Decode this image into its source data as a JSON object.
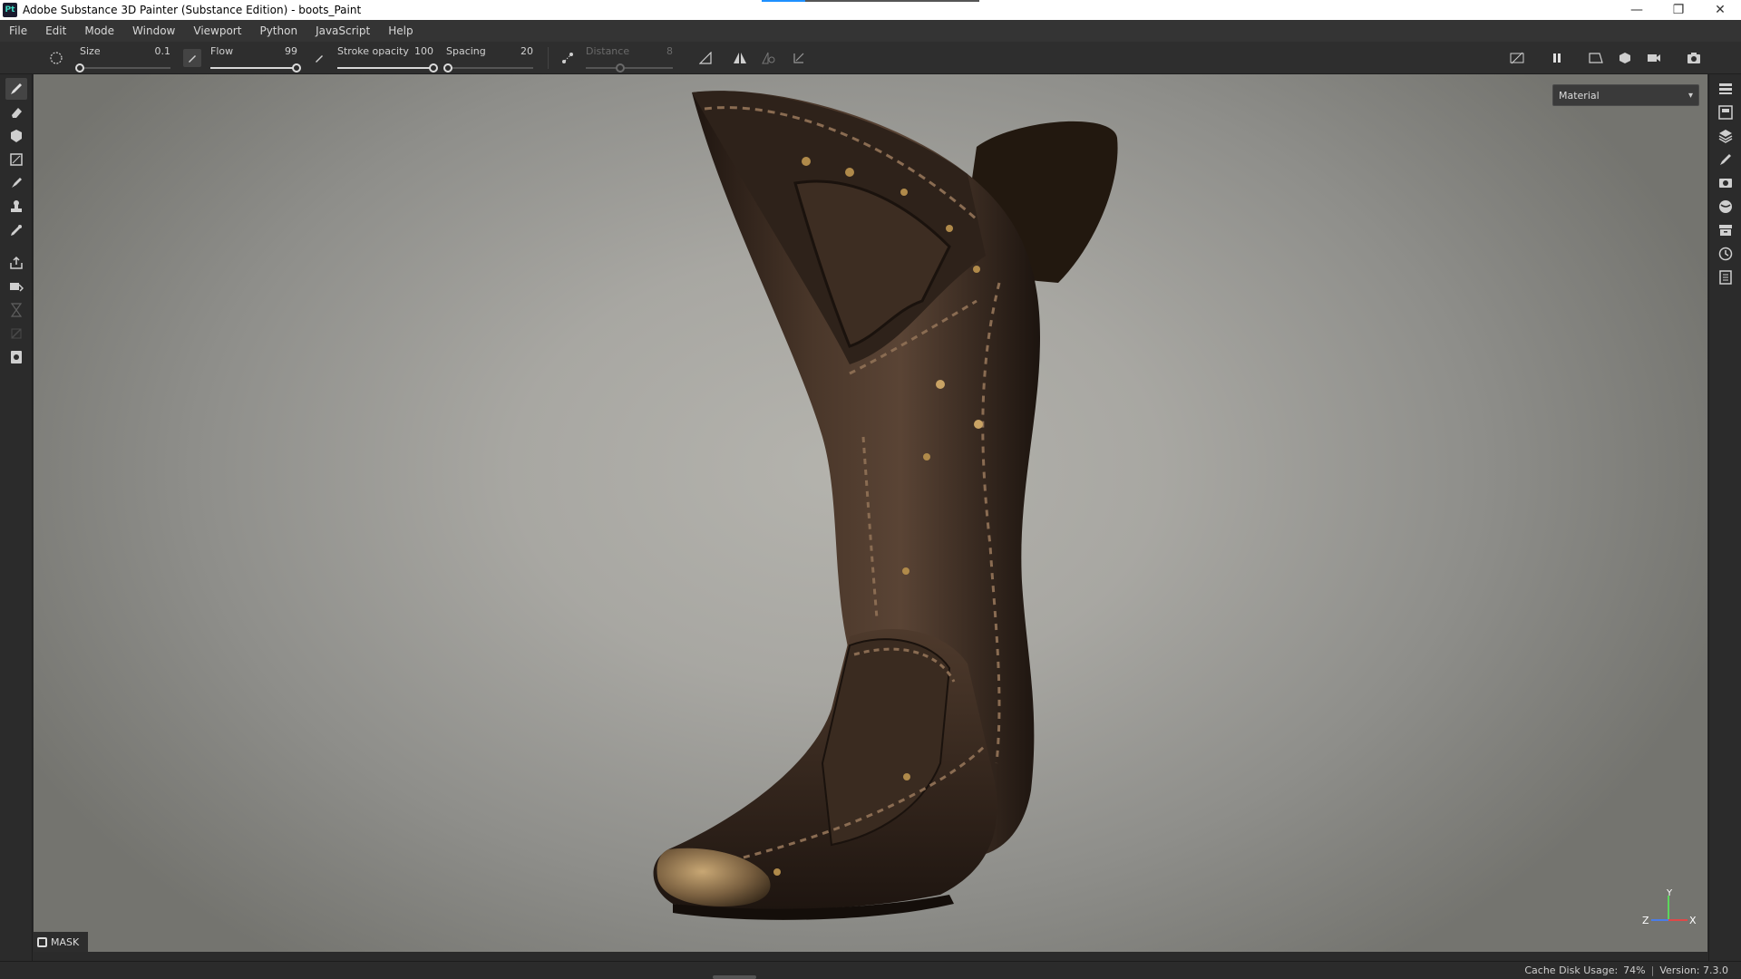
{
  "window": {
    "title": "Adobe Substance 3D Painter (Substance Edition) - boots_Paint",
    "app_badge": "Pt",
    "minimize": "—",
    "restore": "❐",
    "close": "✕"
  },
  "menu": [
    "File",
    "Edit",
    "Mode",
    "Window",
    "Viewport",
    "Python",
    "JavaScript",
    "Help"
  ],
  "toolbar": {
    "size": {
      "label": "Size",
      "value": "0.1",
      "fraction": 0.0
    },
    "flow": {
      "label": "Flow",
      "value": "99",
      "fraction": 0.99
    },
    "stroke_opacity": {
      "label": "Stroke opacity",
      "value": "100",
      "fraction": 1.0
    },
    "spacing": {
      "label": "Spacing",
      "value": "20",
      "fraction": 0.02
    },
    "distance": {
      "label": "Distance",
      "value": "8",
      "fraction": 0.4
    }
  },
  "viewport": {
    "channel_select": "Material",
    "mask_label": "MASK",
    "axes": {
      "y": "Y",
      "z": "Z",
      "x": "X"
    }
  },
  "status": {
    "cache_label": "Cache Disk Usage:",
    "cache_value": "74%",
    "version": "Version: 7.3.0"
  },
  "colors": {
    "leather_dark": "#2a1e17",
    "leather_mid": "#4a362a",
    "stitch": "#8a6c52",
    "rivet": "#b08a4a",
    "toe_metal": "#8a7048"
  }
}
